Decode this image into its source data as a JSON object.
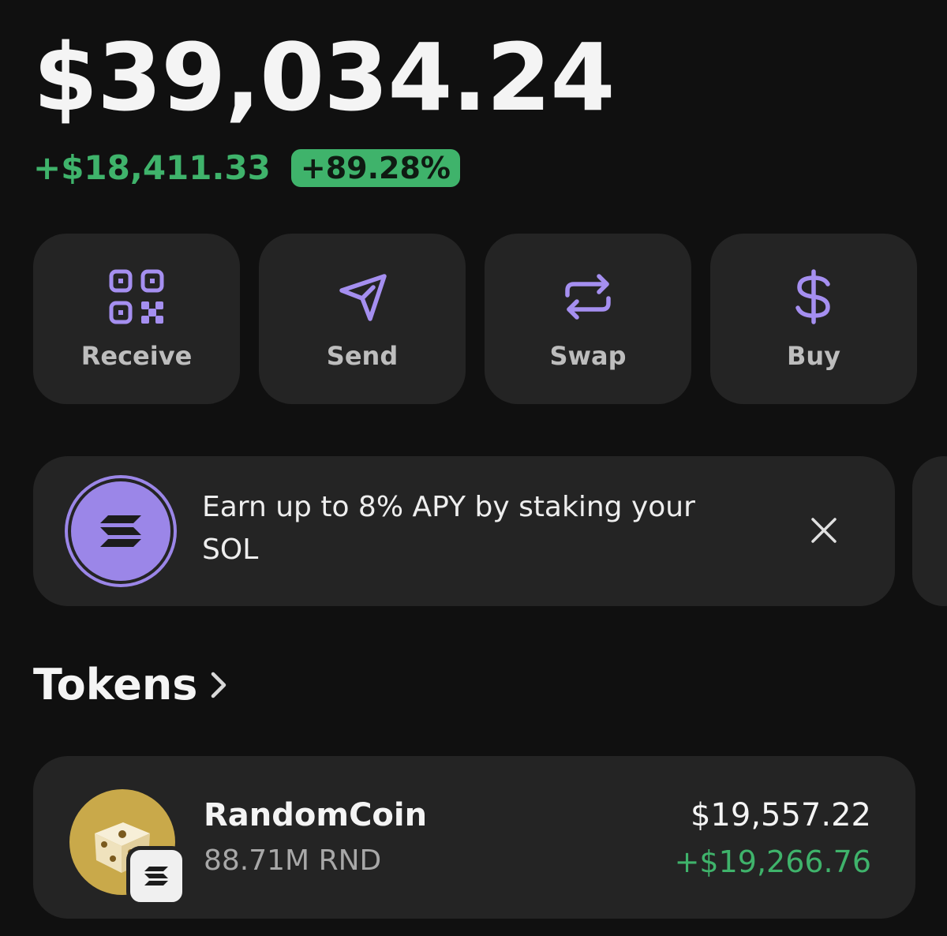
{
  "balance": {
    "total": "$39,034.24",
    "change_amount": "+$18,411.33",
    "change_percent": "+89.28%"
  },
  "actions": [
    {
      "label": "Receive",
      "icon": "qr-code-icon"
    },
    {
      "label": "Send",
      "icon": "send-icon"
    },
    {
      "label": "Swap",
      "icon": "swap-icon"
    },
    {
      "label": "Buy",
      "icon": "dollar-icon"
    }
  ],
  "promo": {
    "text": "Earn up to 8% APY by staking your SOL",
    "icon": "solana-icon",
    "close_icon": "close-icon"
  },
  "tokens_section": {
    "title": "Tokens",
    "chevron_icon": "chevron-right-icon"
  },
  "tokens": [
    {
      "name": "RandomCoin",
      "amount": "88.71M RND",
      "value": "$19,557.22",
      "change": "+$19,266.76",
      "icon": "dice-icon",
      "chain_icon": "solana-icon"
    }
  ],
  "colors": {
    "background": "#101010",
    "card": "#242424",
    "accent": "#9b86e8",
    "positive": "#3fb36b"
  }
}
